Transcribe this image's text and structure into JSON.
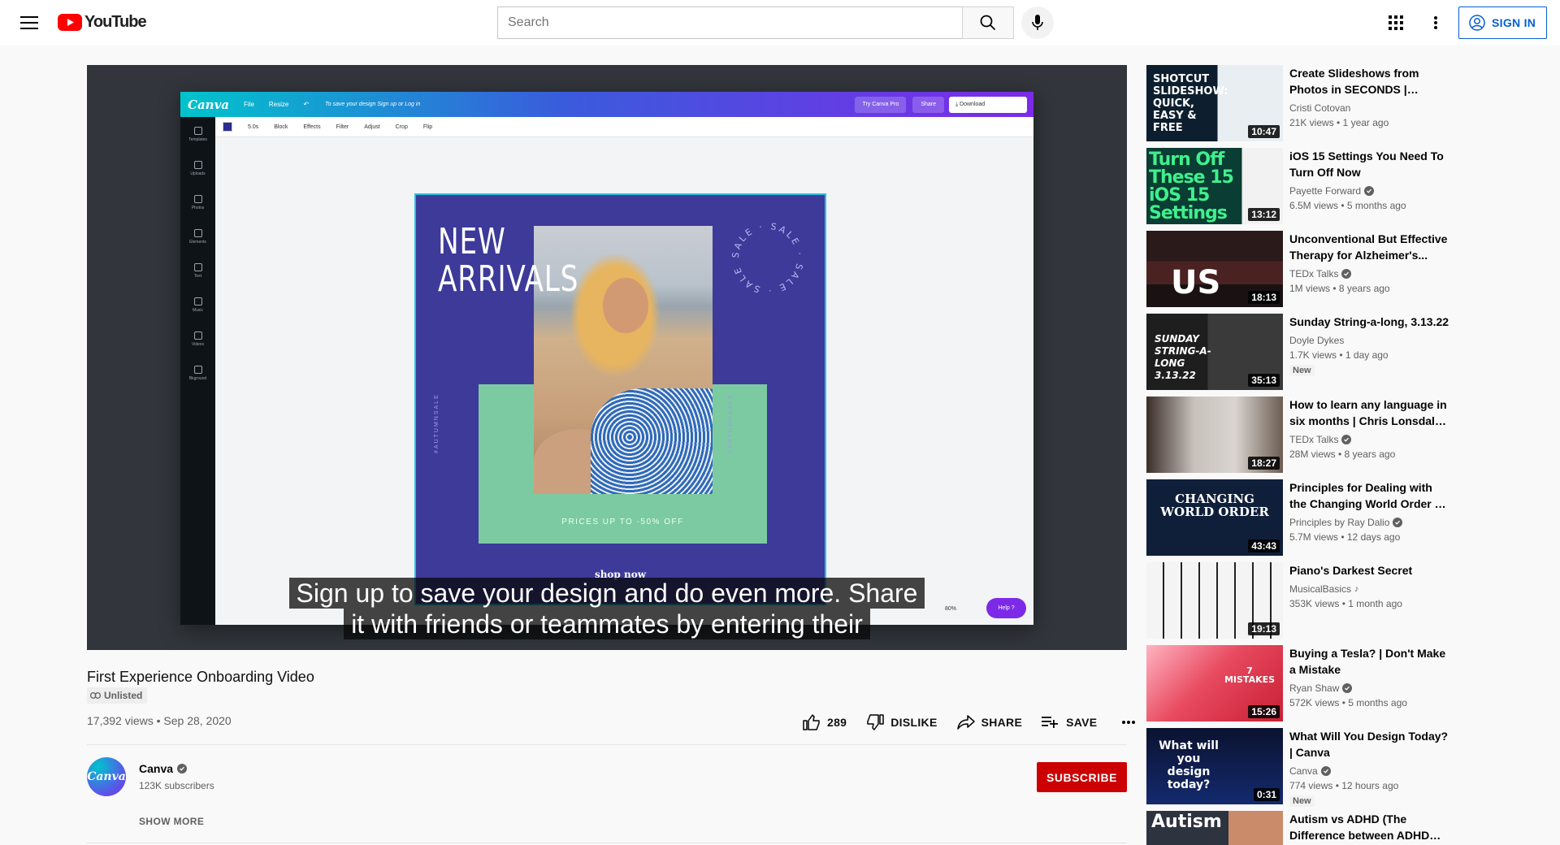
{
  "header": {
    "logo_text": "YouTube",
    "search_placeholder": "Search",
    "signin_label": "SIGN IN"
  },
  "player": {
    "canva": {
      "logo": "Canva",
      "menu": [
        "File",
        "Resize"
      ],
      "save_note": "To save your design Sign up or Log in",
      "try_pro": "Try Canva Pro",
      "share": "Share",
      "download": "Download",
      "sidebar": [
        "Templates",
        "Uploads",
        "Photos",
        "Elements",
        "Text",
        "Music",
        "Videos",
        "Bkground"
      ],
      "toolbar": [
        "5.0s",
        "Block",
        "Effects",
        "Filter",
        "Adjust",
        "Crop",
        "Flip"
      ],
      "zoom": "80%",
      "help": "Help ?"
    },
    "design": {
      "headline_line1": "NEW",
      "headline_line2": "ARRIVALS",
      "sale_ring": "SALE · SALE · SALE · SALE ·",
      "vertical_text": "#AUTUMNSALE",
      "price_text": "PRICES UP TO -50% OFF",
      "shop_text": "shop now"
    },
    "captions": [
      "Sign up to save your design and do even more. Share",
      "it with friends or teammates by entering their"
    ]
  },
  "video": {
    "title": "First Experience Onboarding Video",
    "unlisted": "Unlisted",
    "stats": "17,392 views • Sep 28, 2020",
    "likes": "289",
    "dislike_label": "DISLIKE",
    "share_label": "SHARE",
    "save_label": "SAVE"
  },
  "channel": {
    "avatar_text": "Canva",
    "name": "Canva",
    "subscribers": "123K subscribers",
    "subscribe_label": "SUBSCRIBE",
    "show_more_label": "SHOW MORE"
  },
  "related": [
    {
      "title": "Create Slideshows from Photos in SECONDS | Quickest, Easiest...",
      "channel": "Cristi Cotovan",
      "verified": false,
      "stats": "21K views • 1 year ago",
      "duration": "10:47",
      "thumb_text": "SHOTCUT SLIDESHOW: QUICK, EASY & FREE",
      "badge": ""
    },
    {
      "title": "iOS 15 Settings You Need To Turn Off Now",
      "channel": "Payette Forward",
      "verified": true,
      "stats": "6.5M views • 5 months ago",
      "duration": "13:12",
      "thumb_text": "Turn Off These 15 iOS 15 Settings",
      "badge": ""
    },
    {
      "title": "Unconventional But Effective Therapy for Alzheimer's...",
      "channel": "TEDx Talks",
      "verified": true,
      "stats": "1M views • 8 years ago",
      "duration": "18:13",
      "thumb_text": "US",
      "badge": ""
    },
    {
      "title": "Sunday String-a-long, 3.13.22",
      "channel": "Doyle Dykes",
      "verified": false,
      "stats": "1.7K views • 1 day ago",
      "duration": "35:13",
      "thumb_text": "SUNDAY STRING-A-LONG 3.13.22",
      "badge": "New"
    },
    {
      "title": "How to learn any language in six months | Chris Lonsdale |...",
      "channel": "TEDx Talks",
      "verified": true,
      "stats": "28M views • 8 years ago",
      "duration": "18:27",
      "thumb_text": "",
      "badge": ""
    },
    {
      "title": "Principles for Dealing with the Changing World Order by Ray...",
      "channel": "Principles by Ray Dalio",
      "verified": true,
      "stats": "5.7M views • 12 days ago",
      "duration": "43:43",
      "thumb_text": "CHANGING WORLD ORDER",
      "badge": ""
    },
    {
      "title": "Piano's Darkest Secret",
      "channel": "MusicalBasics",
      "verified": true,
      "stats": "353K views • 1 month ago",
      "duration": "19:13",
      "thumb_text": "",
      "badge": ""
    },
    {
      "title": "Buying a Tesla? | Don't Make a Mistake",
      "channel": "Ryan Shaw",
      "verified": true,
      "stats": "572K views • 5 months ago",
      "duration": "15:26",
      "thumb_text": "7 MISTAKES",
      "badge": ""
    },
    {
      "title": "What Will You Design Today? | Canva",
      "channel": "Canva",
      "verified": true,
      "stats": "774 views • 12 hours ago",
      "duration": "0:31",
      "thumb_text": "What will you design today?",
      "badge": "New"
    },
    {
      "title": "Autism vs ADHD (The Difference between ADHD and...",
      "channel": "",
      "verified": false,
      "stats": "",
      "duration": "",
      "thumb_text": "Autism",
      "badge": ""
    }
  ]
}
